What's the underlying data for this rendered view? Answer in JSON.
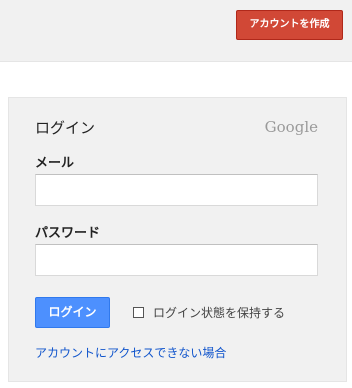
{
  "header": {
    "create_account_label": "アカウントを作成"
  },
  "login": {
    "title": "ログイン",
    "brand": "Google",
    "email_label": "メール",
    "email_value": "",
    "password_label": "パスワード",
    "password_value": "",
    "submit_label": "ログイン",
    "remember_label": "ログイン状態を保持する",
    "remember_checked": false,
    "help_link": "アカウントにアクセスできない場合"
  },
  "colors": {
    "create_button": "#d14836",
    "login_button": "#4d90fe",
    "link": "#1155cc",
    "card_background": "#f1f1f1"
  }
}
